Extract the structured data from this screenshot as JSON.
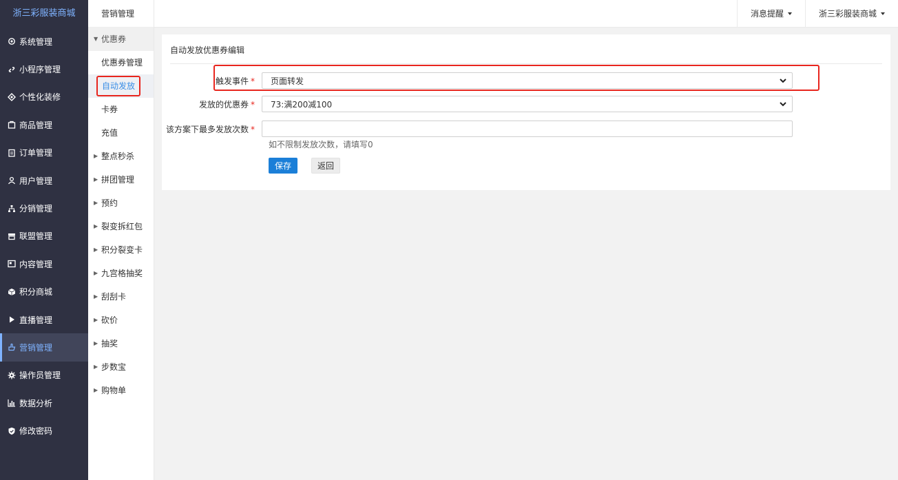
{
  "brand": {
    "name": "浙三彩服装商城"
  },
  "sidebar": {
    "items": [
      {
        "label": "系统管理",
        "icon": "gear-icon"
      },
      {
        "label": "小程序管理",
        "icon": "link-icon"
      },
      {
        "label": "个性化装修",
        "icon": "diamond-icon"
      },
      {
        "label": "商品管理",
        "icon": "box-icon"
      },
      {
        "label": "订单管理",
        "icon": "clipboard-icon"
      },
      {
        "label": "用户管理",
        "icon": "user-icon"
      },
      {
        "label": "分销管理",
        "icon": "sitemap-icon"
      },
      {
        "label": "联盟管理",
        "icon": "store-icon"
      },
      {
        "label": "内容管理",
        "icon": "content-icon"
      },
      {
        "label": "积分商城",
        "icon": "cube-icon"
      },
      {
        "label": "直播管理",
        "icon": "play-icon"
      },
      {
        "label": "营销管理",
        "icon": "hand-icon",
        "active": true
      },
      {
        "label": "操作员管理",
        "icon": "cog-icon"
      },
      {
        "label": "数据分析",
        "icon": "bar-chart-icon"
      },
      {
        "label": "修改密码",
        "icon": "shield-icon"
      }
    ]
  },
  "subnav": {
    "title": "营销管理",
    "coupon_group": "优惠券",
    "coupon_children": [
      "优惠券管理",
      "自动发放",
      "卡券",
      "充值"
    ],
    "groups": [
      "整点秒杀",
      "拼团管理",
      "预约",
      "裂变拆红包",
      "积分裂变卡",
      "九宫格抽奖",
      "刮刮卡",
      "砍价",
      "抽奖",
      "步数宝",
      "购物单"
    ]
  },
  "header": {
    "notify_label": "消息提醒",
    "shop_label": "浙三彩服装商城"
  },
  "form": {
    "title": "自动发放优惠券编辑",
    "trigger_label": "触发事件",
    "trigger_value": "页面转发",
    "coupon_label": "发放的优惠券",
    "coupon_value": "73:满200减100",
    "max_label": "该方案下最多发放次数",
    "max_value": "",
    "hint": "如不限制发放次数，请填写0",
    "save_label": "保存",
    "back_label": "返回",
    "required_mark": "*"
  },
  "colors": {
    "sidebar_bg": "#2f3142",
    "accent": "#7fb3ff",
    "primary_button": "#1b7fd8",
    "highlight": "#e8251d"
  }
}
